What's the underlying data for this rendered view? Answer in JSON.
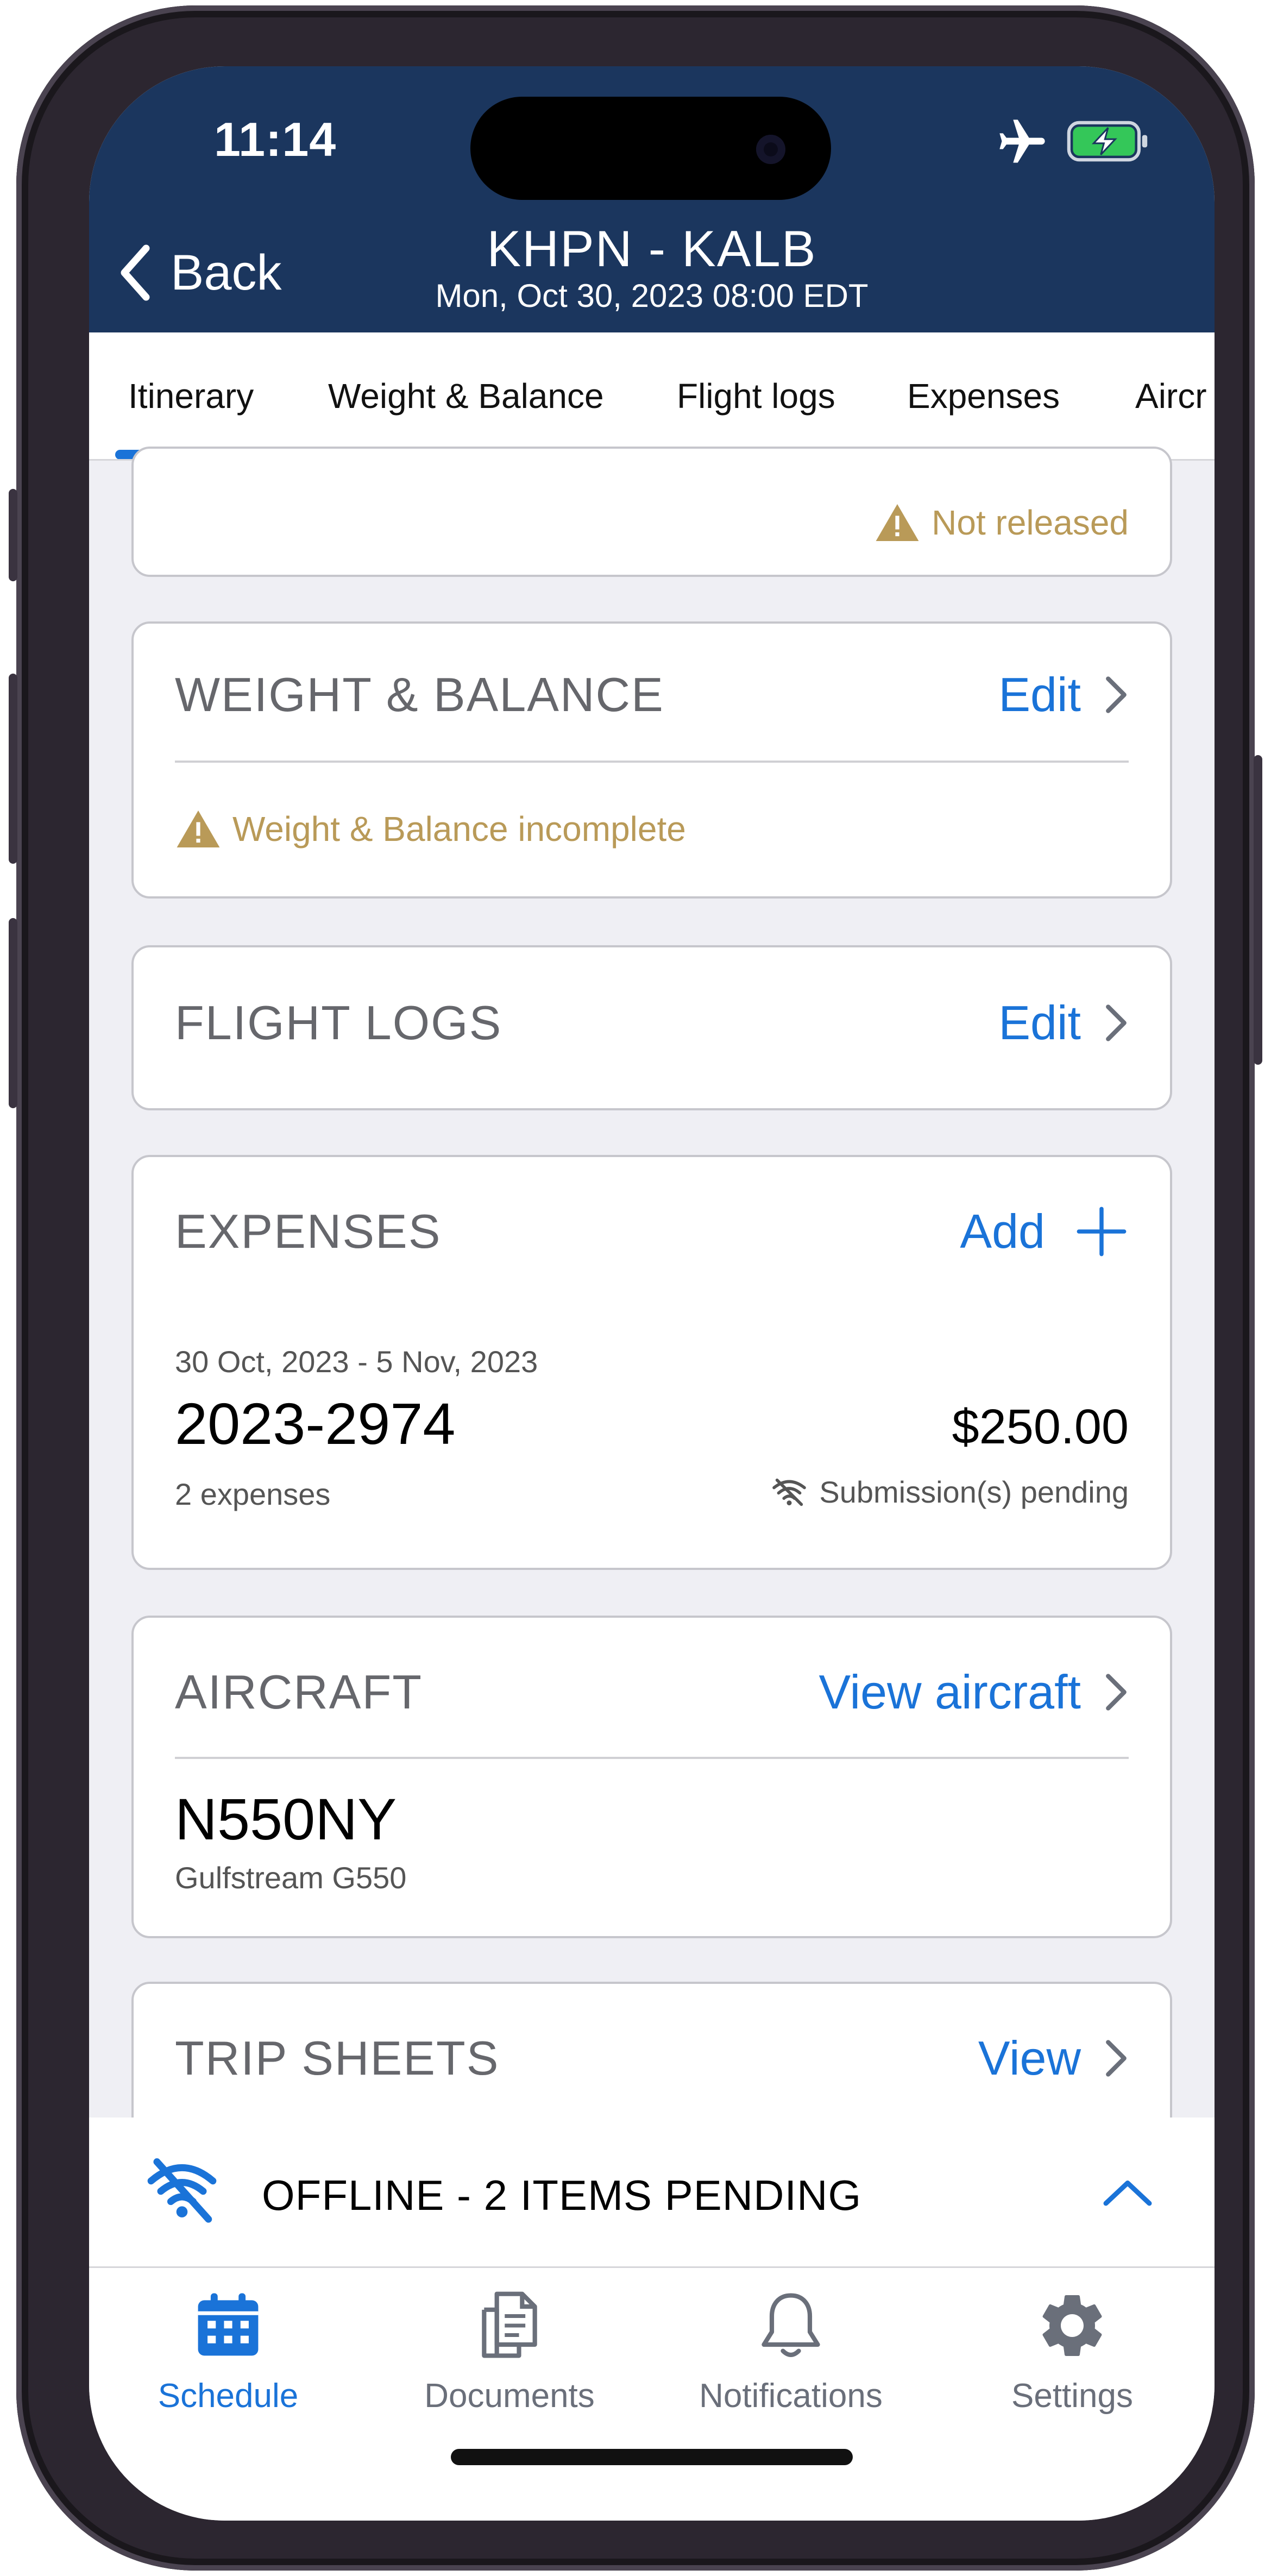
{
  "status_bar": {
    "time": "11:14"
  },
  "header": {
    "back_label": "Back",
    "title": "KHPN - KALB",
    "subtitle": "Mon, Oct 30, 2023 08:00 EDT"
  },
  "tabs": [
    {
      "label": "Itinerary",
      "active": true
    },
    {
      "label": "Weight & Balance"
    },
    {
      "label": "Flight logs"
    },
    {
      "label": "Expenses"
    },
    {
      "label": "Aircr"
    }
  ],
  "release_card": {
    "status": "Not released"
  },
  "weight_balance": {
    "title": "WEIGHT & BALANCE",
    "action": "Edit",
    "warning": "Weight & Balance incomplete"
  },
  "flight_logs": {
    "title": "FLIGHT LOGS",
    "action": "Edit"
  },
  "expenses": {
    "title": "EXPENSES",
    "action": "Add",
    "report": {
      "date_range": "30 Oct, 2023 - 5 Nov, 2023",
      "id": "2023-2974",
      "amount": "$250.00",
      "count": "2 expenses",
      "status": "Submission(s) pending"
    }
  },
  "aircraft": {
    "title": "AIRCRAFT",
    "action": "View aircraft",
    "tail": "N550NY",
    "model": "Gulfstream G550"
  },
  "trip_sheets": {
    "title": "TRIP SHEETS",
    "action": "View"
  },
  "offline": {
    "message": "OFFLINE - 2 ITEMS PENDING"
  },
  "bottom_nav": [
    {
      "label": "Schedule",
      "icon": "calendar-icon",
      "active": true
    },
    {
      "label": "Documents",
      "icon": "documents-icon"
    },
    {
      "label": "Notifications",
      "icon": "bell-icon"
    },
    {
      "label": "Settings",
      "icon": "gear-icon"
    }
  ],
  "colors": {
    "header_bg": "#1b365e",
    "accent": "#1a73d8",
    "warning": "#b99a58",
    "battery": "#34c759"
  }
}
